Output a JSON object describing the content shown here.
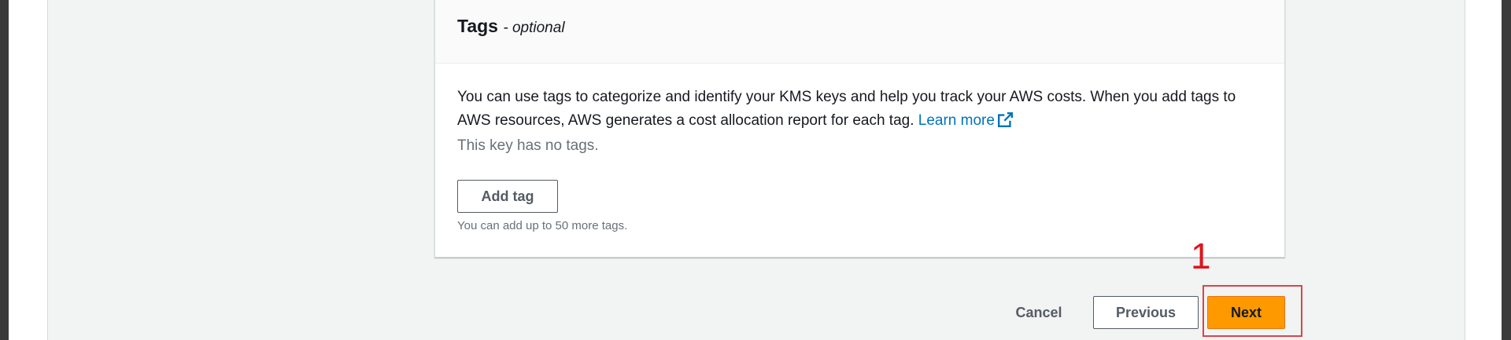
{
  "tags_panel": {
    "title": "Tags",
    "title_suffix": "- optional",
    "description": "You can use tags to categorize and identify your KMS keys and help you track your AWS costs. When you add tags to AWS resources, AWS generates a cost allocation report for each tag.",
    "learn_more": "Learn more",
    "no_tags": "This key has no tags.",
    "add_tag_label": "Add tag",
    "hint": "You can add up to 50 more tags."
  },
  "footer": {
    "cancel_label": "Cancel",
    "previous_label": "Previous",
    "next_label": "Next"
  },
  "annotation": {
    "number": "1"
  },
  "colors": {
    "primary_button": "#ff9900",
    "link": "#0073bb",
    "annotation": "#e0141e"
  },
  "icons": {
    "learn_more": "external-link-icon"
  }
}
